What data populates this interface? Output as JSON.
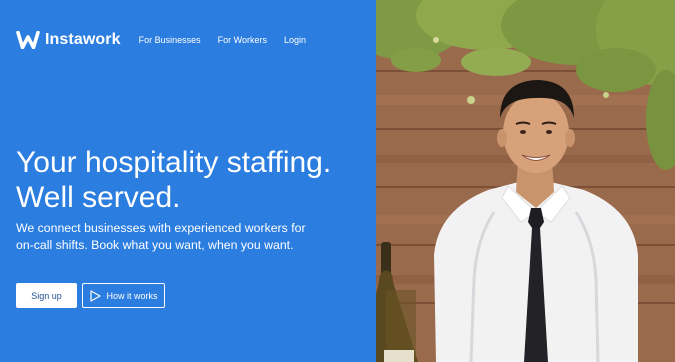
{
  "brand": {
    "name": "Instawork",
    "primary_color": "#2b7de0"
  },
  "nav": {
    "links": [
      {
        "label": "For Businesses"
      },
      {
        "label": "For Workers"
      },
      {
        "label": "Login"
      }
    ]
  },
  "hero": {
    "headline_line1": "Your hospitality staffing.",
    "headline_line2": "Well served.",
    "subtext": "We connect businesses with experienced workers for on-call shifts. Book what you want, when you want.",
    "cta_primary": "Sign up",
    "cta_secondary": "How it works",
    "cta_secondary_icon": "play-icon"
  },
  "photo": {
    "subject": "smiling waiter in white shirt and black tie",
    "icon": "hero-photo"
  }
}
